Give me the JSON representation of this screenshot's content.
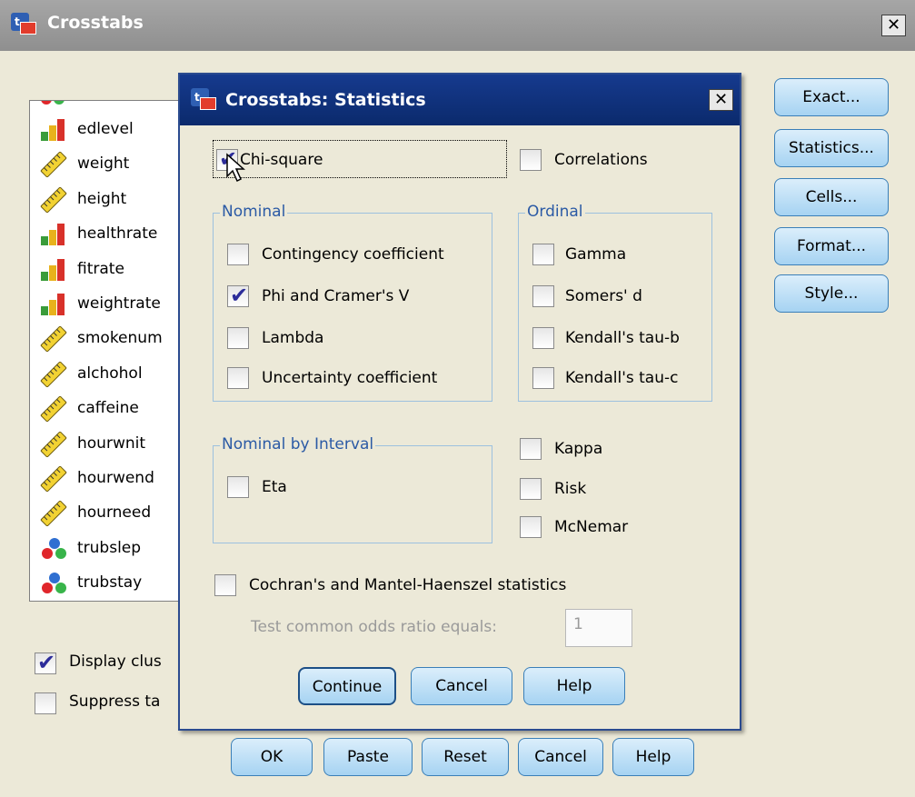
{
  "window": {
    "title": "Crosstabs",
    "close_glyph": "✕"
  },
  "variables": [
    {
      "name": "edlevel",
      "icon": "ordinal-bar-icon"
    },
    {
      "name": "weight",
      "icon": "scale-ruler-icon"
    },
    {
      "name": "height",
      "icon": "scale-ruler-icon"
    },
    {
      "name": "healthrate",
      "icon": "ordinal-bar-icon"
    },
    {
      "name": "fitrate",
      "icon": "ordinal-bar-icon"
    },
    {
      "name": "weightrate",
      "icon": "ordinal-bar-icon"
    },
    {
      "name": "smokenum",
      "icon": "scale-ruler-icon"
    },
    {
      "name": "alchohol",
      "icon": "scale-ruler-icon"
    },
    {
      "name": "caffeine",
      "icon": "scale-ruler-icon"
    },
    {
      "name": "hourwnit",
      "icon": "scale-ruler-icon"
    },
    {
      "name": "hourwend",
      "icon": "scale-ruler-icon"
    },
    {
      "name": "hourneed",
      "icon": "scale-ruler-icon"
    },
    {
      "name": "trubslep",
      "icon": "nominal-balls-icon"
    },
    {
      "name": "trubstay",
      "icon": "nominal-balls-icon"
    }
  ],
  "side_buttons": [
    "Exact...",
    "Statistics...",
    "Cells...",
    "Format...",
    "Style..."
  ],
  "options": {
    "display_clustered": {
      "label": "Display clus",
      "checked": true
    },
    "suppress_tables": {
      "label": "Suppress ta",
      "checked": false
    }
  },
  "bottom_buttons": {
    "ok": "OK",
    "paste": "Paste",
    "reset": "Reset",
    "cancel": "Cancel",
    "help": "Help"
  },
  "dialog": {
    "title": "Crosstabs: Statistics",
    "close_glyph": "✕",
    "chi_square": {
      "label": "Chi-square",
      "checked": true
    },
    "correlations": {
      "label": "Correlations",
      "checked": false
    },
    "nominal": {
      "title": "Nominal",
      "items": [
        {
          "label": "Contingency coefficient",
          "checked": false
        },
        {
          "label": "Phi and Cramer's V",
          "checked": true
        },
        {
          "label": "Lambda",
          "checked": false
        },
        {
          "label": "Uncertainty coefficient",
          "checked": false
        }
      ]
    },
    "ordinal": {
      "title": "Ordinal",
      "items": [
        {
          "label": "Gamma",
          "checked": false
        },
        {
          "label": "Somers' d",
          "checked": false
        },
        {
          "label": "Kendall's tau-b",
          "checked": false
        },
        {
          "label": "Kendall's tau-c",
          "checked": false
        }
      ]
    },
    "nominal_by_interval": {
      "title": "Nominal by Interval",
      "eta": {
        "label": "Eta",
        "checked": false
      }
    },
    "kappa": {
      "label": "Kappa",
      "checked": false
    },
    "risk": {
      "label": "Risk",
      "checked": false
    },
    "mcnemar": {
      "label": "McNemar",
      "checked": false
    },
    "cochran": {
      "label": "Cochran's and Mantel-Haenszel statistics",
      "checked": false
    },
    "odds_ratio": {
      "label": "Test common odds ratio equals:",
      "value": "1"
    },
    "buttons": {
      "continue": "Continue",
      "cancel": "Cancel",
      "help": "Help"
    }
  },
  "colors": {
    "title_gray": "#a6a6a6",
    "dialog_title_blue": "#163a8e",
    "button_blue": "#a6d3f2",
    "group_label_blue": "#2b5aa5",
    "check_mark": "#2c2c9a"
  }
}
